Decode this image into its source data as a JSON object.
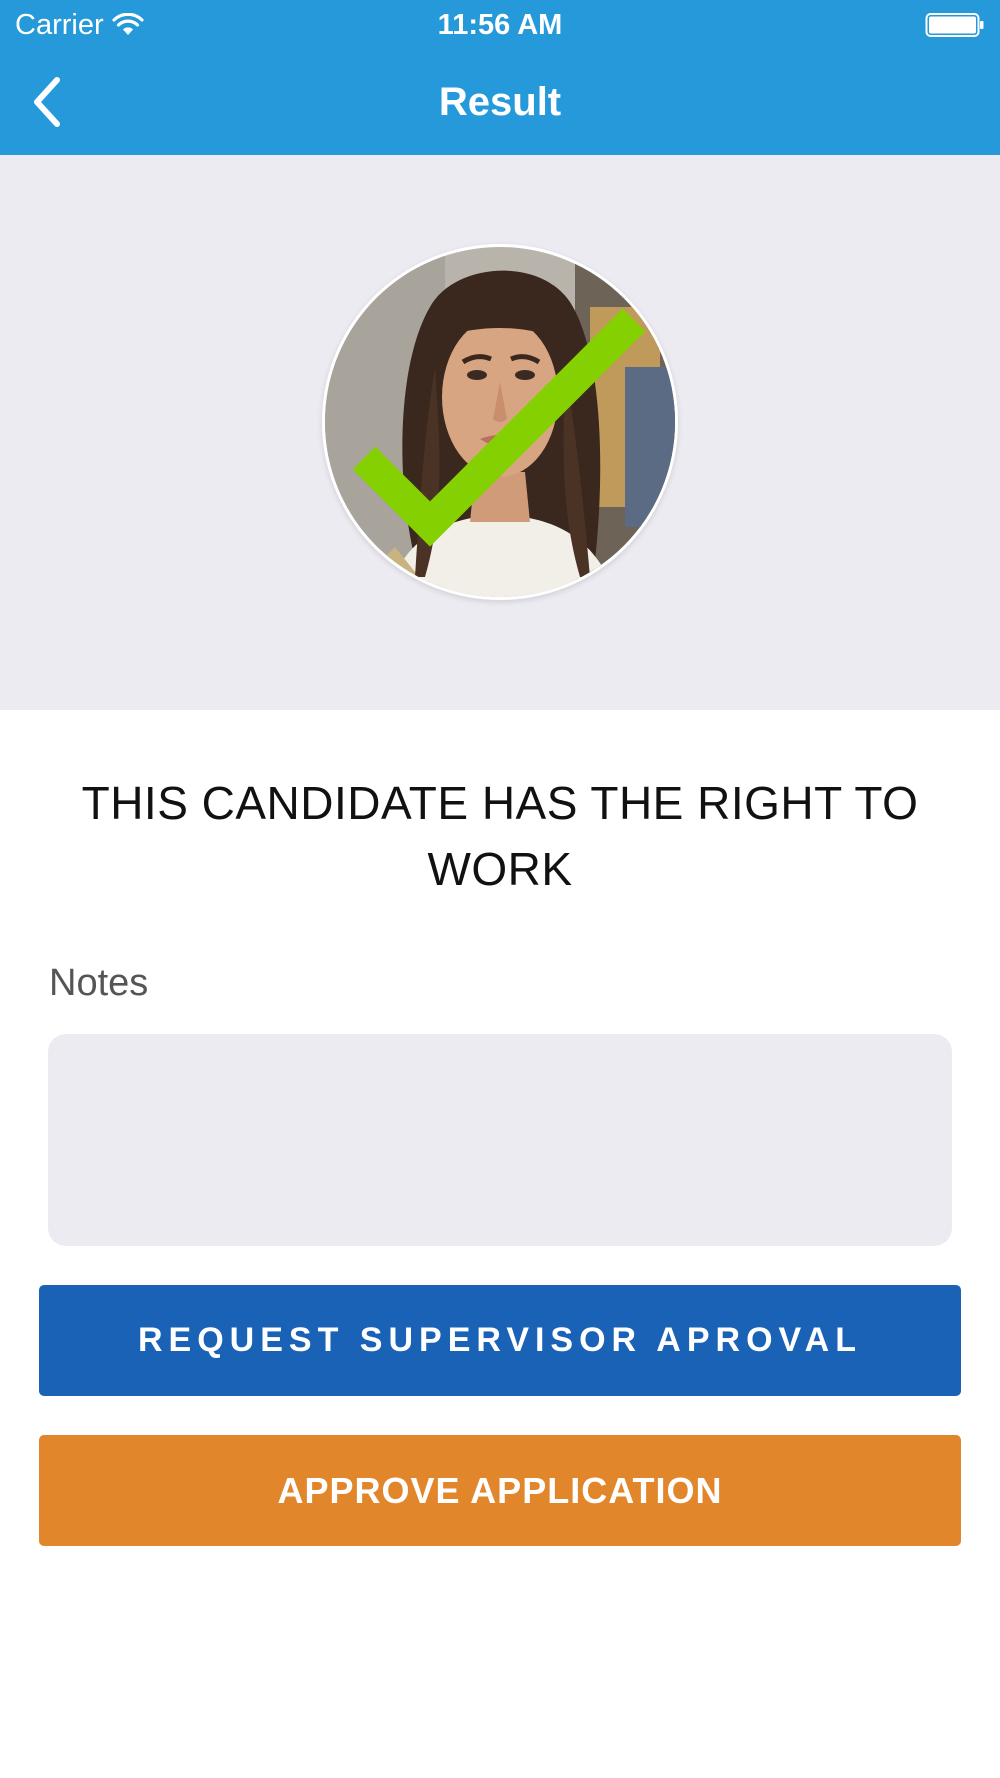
{
  "status_bar": {
    "carrier": "Carrier",
    "time": "11:56 AM",
    "wifi_icon": "wifi-icon",
    "battery_icon": "battery-icon"
  },
  "nav": {
    "title": "Result",
    "back_icon": "chevron-left-icon"
  },
  "candidate": {
    "photo_icon": "candidate-photo",
    "status_icon": "checkmark-icon",
    "result_text": "THIS CANDIDATE HAS THE RIGHT TO WORK"
  },
  "notes": {
    "label": "Notes",
    "value": "",
    "placeholder": ""
  },
  "actions": {
    "request_label": "REQUEST SUPERVISOR APROVAL",
    "approve_label": "APPROVE APPLICATION"
  },
  "colors": {
    "header": "#2599d9",
    "panel": "#ecebf1",
    "check": "#84d000",
    "request_button": "#1962b5",
    "approve_button": "#e2862b"
  }
}
